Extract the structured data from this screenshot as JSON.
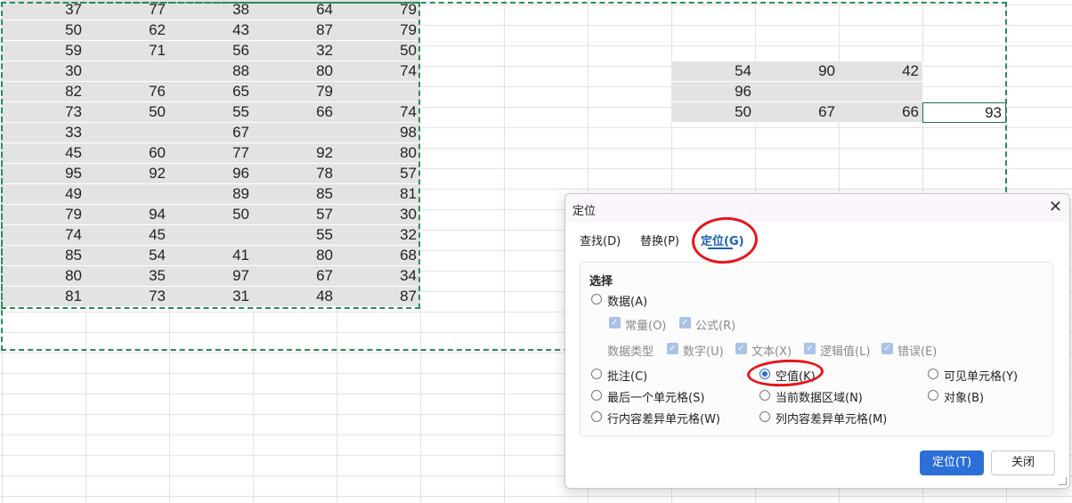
{
  "sheet": {
    "left_block": [
      [
        "37",
        "77",
        "38",
        "64",
        "79"
      ],
      [
        "50",
        "62",
        "43",
        "87",
        "79"
      ],
      [
        "59",
        "71",
        "56",
        "32",
        "50"
      ],
      [
        "30",
        "",
        "88",
        "80",
        "74"
      ],
      [
        "82",
        "76",
        "65",
        "79",
        ""
      ],
      [
        "73",
        "50",
        "55",
        "66",
        "74"
      ],
      [
        "33",
        "",
        "67",
        "",
        "98"
      ],
      [
        "45",
        "60",
        "77",
        "92",
        "80"
      ],
      [
        "95",
        "92",
        "96",
        "78",
        "57"
      ],
      [
        "49",
        "",
        "89",
        "85",
        "81"
      ],
      [
        "79",
        "94",
        "50",
        "57",
        "30"
      ],
      [
        "74",
        "45",
        "",
        "55",
        "32"
      ],
      [
        "85",
        "54",
        "41",
        "80",
        "68"
      ],
      [
        "80",
        "35",
        "97",
        "67",
        "34"
      ],
      [
        "81",
        "73",
        "31",
        "48",
        "87"
      ]
    ],
    "right_block": [
      [
        "54",
        "90",
        "42"
      ],
      [
        "96",
        "",
        ""
      ],
      [
        "50",
        "67",
        "66"
      ]
    ],
    "active_cell": "93"
  },
  "dialog": {
    "title": "定位",
    "close_glyph": "✕",
    "tabs": [
      {
        "label": "查找(D)"
      },
      {
        "label": "替换(P)"
      },
      {
        "label": "定位(G)"
      }
    ],
    "group_title": "选择",
    "option_data": "数据(A)",
    "check_constant": "常量(O)",
    "check_formula": "公式(R)",
    "data_type_label": "数据类型",
    "check_number": "数字(U)",
    "check_text": "文本(X)",
    "check_logical": "逻辑值(L)",
    "check_error": "错误(E)",
    "option_comment": "批注(C)",
    "option_blank": "空值(K)",
    "option_visible": "可见单元格(Y)",
    "option_last_cell": "最后一个单元格(S)",
    "option_current_region": "当前数据区域(N)",
    "option_object": "对象(B)",
    "option_row_diff": "行内容差异单元格(W)",
    "option_col_diff": "列内容差异单元格(M)",
    "selected_option": "空值(K)",
    "btn_locate": "定位(T)",
    "btn_close": "关闭"
  },
  "colors": {
    "accent": "#2c6fd6",
    "selection_fill": "#e3e3e3",
    "marching_ants": "#2a8a5a",
    "annotation": "#e8131a"
  }
}
